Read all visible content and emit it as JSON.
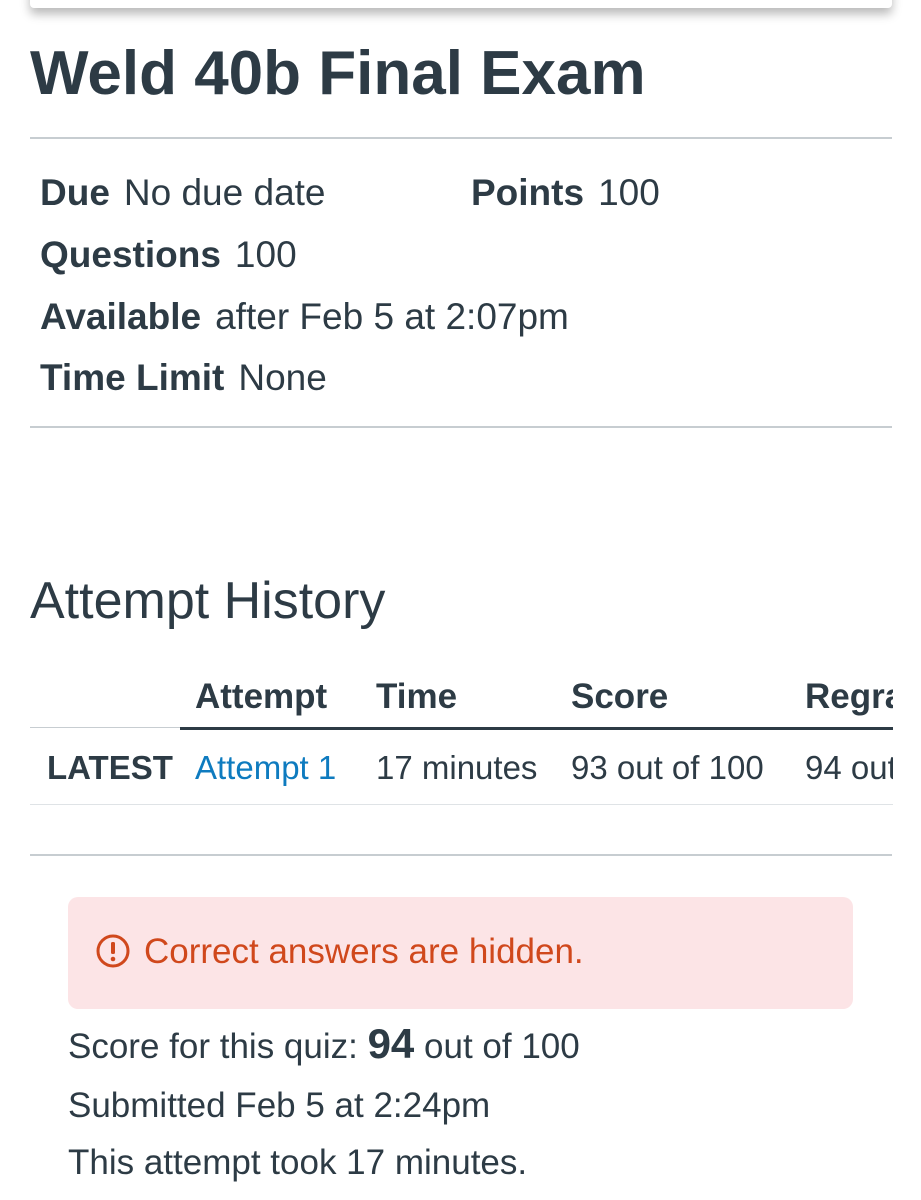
{
  "quiz": {
    "title": "Weld 40b Final Exam"
  },
  "details": {
    "due_label": "Due",
    "due_value": "No due date",
    "points_label": "Points",
    "points_value": "100",
    "questions_label": "Questions",
    "questions_value": "100",
    "available_label": "Available",
    "available_value": "after Feb 5 at 2:07pm",
    "time_limit_label": "Time Limit",
    "time_limit_value": "None"
  },
  "attempt_history": {
    "title": "Attempt History",
    "columns": [
      "Attempt",
      "Time",
      "Score",
      "Regra"
    ],
    "rows": [
      {
        "tag": "LATEST",
        "attempt": "Attempt 1",
        "time": "17 minutes",
        "score": "93 out of 100",
        "regrade": "94 out"
      }
    ]
  },
  "alert": {
    "icon": "exclamation-circle-icon",
    "message": "Correct answers are hidden.",
    "color": "#d0481c",
    "background": "#fce4e6"
  },
  "result": {
    "score_prefix": "Score for this quiz:",
    "score_value": "94",
    "score_suffix": "out of 100",
    "submitted": "Submitted Feb 5 at 2:24pm",
    "duration": "This attempt took 17 minutes."
  },
  "colors": {
    "text": "#2d3b45",
    "link": "#0e7bbf",
    "divider": "#c7cdd1"
  }
}
